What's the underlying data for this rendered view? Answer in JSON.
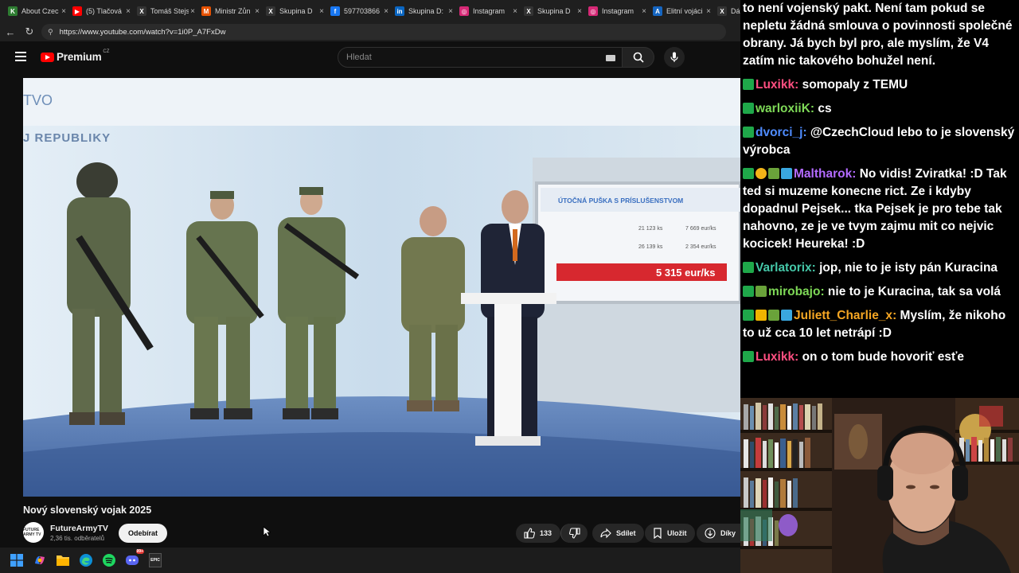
{
  "browser": {
    "tabs": [
      {
        "title": "About Czec",
        "icon": "tab-favicon-k",
        "color": "#2e7d32",
        "glyph": "K"
      },
      {
        "title": "(5) Tlačová",
        "icon": "tab-favicon-youtube",
        "color": "#ff0000",
        "glyph": "▶"
      },
      {
        "title": "Tomáš Stejs",
        "icon": "tab-favicon-x",
        "color": "#333333",
        "glyph": "X"
      },
      {
        "title": "Ministr Zůn",
        "icon": "tab-favicon-m",
        "color": "#e65100",
        "glyph": "M"
      },
      {
        "title": "Skupina D",
        "icon": "tab-favicon-x",
        "color": "#333333",
        "glyph": "X"
      },
      {
        "title": "597703866",
        "icon": "tab-favicon-facebook",
        "color": "#1877f2",
        "glyph": "f"
      },
      {
        "title": "Skupina D:",
        "icon": "tab-favicon-linkedin",
        "color": "#0a66c2",
        "glyph": "in"
      },
      {
        "title": "Instagram",
        "icon": "tab-favicon-instagram",
        "color": "#d62976",
        "glyph": "◎"
      },
      {
        "title": "Skupina D",
        "icon": "tab-favicon-x",
        "color": "#333333",
        "glyph": "X"
      },
      {
        "title": "Instagram",
        "icon": "tab-favicon-instagram",
        "color": "#d62976",
        "glyph": "◎"
      },
      {
        "title": "Elitní vojáci",
        "icon": "tab-favicon-a",
        "color": "#1565c0",
        "glyph": "A"
      },
      {
        "title": "Dár",
        "icon": "tab-favicon-x",
        "color": "#333333",
        "glyph": "X"
      }
    ],
    "url": "https://www.youtube.com/watch?v=1i0P_A7FxDw"
  },
  "youtube": {
    "logo_text": "Premium",
    "country_code": "CZ",
    "search_placeholder": "Hledat",
    "video": {
      "slide_title": "ÚTOČNÁ PUŠKA S PRÍSLUŠENSTVOM",
      "slide_rows": [
        {
          "a": "21 123 ks",
          "b": "7 669 eur/ks"
        },
        {
          "a": "26 139 ks",
          "b": "2 354 eur/ks"
        }
      ],
      "slide_total": "5 315 eur/ks",
      "wall_text_top": "TVO",
      "wall_text_main": "J REPUBLIKY"
    },
    "title": "Nový slovenský vojak 2025",
    "channel": {
      "name": "FutureArmyTV",
      "subscribers": "2,36 tis. odběratelů",
      "avatar_text": "FUTURE ARMY TV",
      "subscribe_label": "Odebírat"
    },
    "actions": {
      "like_count": "133",
      "share_label": "Sdílet",
      "save_label": "Uložit",
      "thanks_label": "Díky"
    }
  },
  "taskbar": {
    "icons": [
      "windows-start-icon",
      "copilot-icon",
      "file-explorer-icon",
      "edge-icon",
      "spotify-icon",
      "discord-icon",
      "epic-games-icon"
    ],
    "discord_badge": "99+",
    "epic_label": "EPIC"
  },
  "chat": {
    "messages": [
      {
        "user": "",
        "color": "#ffffff",
        "badges": [],
        "text": "to není vojenský pakt. Není tam pokud se nepletu žádná smlouva o povinnosti společné obrany. Já bych byl pro, ale myslím, že V4 zatím nic takového bohužel není."
      },
      {
        "user": "Luxikk",
        "color": "#ff4f81",
        "badges": [
          "k"
        ],
        "text": "somopaly z TEMU"
      },
      {
        "user": "warloxiiK",
        "color": "#7ed957",
        "badges": [
          "k"
        ],
        "text": "cs"
      },
      {
        "user": "dvorci_j",
        "color": "#4f8cff",
        "badges": [
          "k"
        ],
        "text": "@CzechCloud lebo to je slovenský výrobca"
      },
      {
        "user": "Maltharok",
        "color": "#b36bff",
        "badges": [
          "k",
          "coin",
          "leaf",
          "cube"
        ],
        "text": "No vidis! Zviratka! :D Tak ted si muzeme konecne rict. Ze i kdyby dopadnul Pejsek... tka Pejsek je pro tebe tak nahovno, ze je ve tvym zajmu mit co nejvic kocicek! Heureka! :D"
      },
      {
        "user": "Varlatorix",
        "color": "#45c7a8",
        "badges": [
          "k"
        ],
        "text": "jop, nie to je isty pán Kuracina"
      },
      {
        "user": "mirobajo",
        "color": "#7ed957",
        "badges": [
          "k",
          "leaf"
        ],
        "text": "nie to je Kuracina, tak sa volá"
      },
      {
        "user": "Juliett_Charlie_x",
        "color": "#f5a623",
        "badges": [
          "k",
          "crown",
          "leaf",
          "cube"
        ],
        "text": "Myslím, že nikoho to už cca 10 let netrápí :D"
      },
      {
        "user": "Luxikk",
        "color": "#ff4f81",
        "badges": [
          "k"
        ],
        "text": "on o tom bude hovoriť esťe"
      }
    ]
  }
}
